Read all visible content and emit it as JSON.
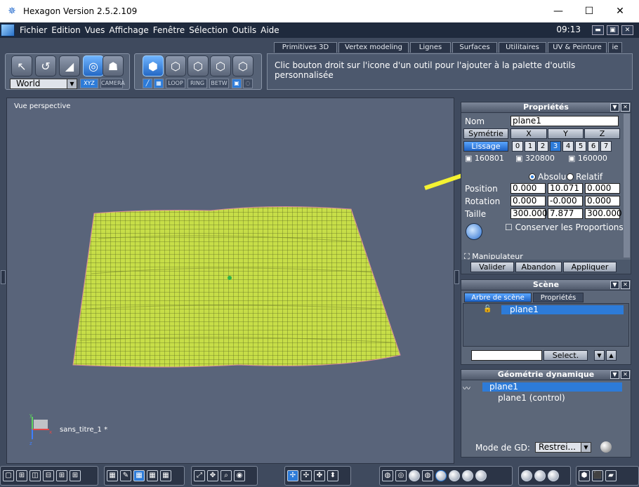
{
  "window": {
    "title": "Hexagon Version 2.5.2.109",
    "minimize": "—",
    "maximize": "☐",
    "close": "✕"
  },
  "menu": {
    "items": [
      "Fichier",
      "Edition",
      "Vues",
      "Affichage",
      "Fenêtre",
      "Sélection",
      "Outils",
      "Aide"
    ],
    "clock": "09:13"
  },
  "tabs": [
    "Primitives 3D",
    "Vertex modeling",
    "Lignes",
    "Surfaces",
    "Utilitaires",
    "UV & Peinture",
    "ie"
  ],
  "hint": "Clic bouton droit sur l'icone d'un outil pour l'ajouter à la palette d'outils personnalisée",
  "toolbar": {
    "coord_select": "World",
    "xyz": "XYZ",
    "camera": "CAMERA",
    "modes": [
      "LOOP",
      "RING",
      "BETW"
    ]
  },
  "viewport": {
    "label": "Vue perspective",
    "doc": "sans_titre_1 *",
    "axes": {
      "x": "x",
      "y": "y",
      "z": "z"
    }
  },
  "props": {
    "title": "Propriétés",
    "name_label": "Nom",
    "name_value": "plane1",
    "symmetry": "Symétrie",
    "axes": [
      "X",
      "Y",
      "Z"
    ],
    "smoothing": "Lissage",
    "levels": [
      "0",
      "1",
      "2",
      "3",
      "4",
      "5",
      "6",
      "7"
    ],
    "selected_level": "3",
    "counts": [
      "160801",
      "320800",
      "160000"
    ],
    "absolute": "Absolu",
    "relative": "Relatif",
    "rows": [
      {
        "label": "Position",
        "v": [
          "0.000",
          "10.071",
          "0.000"
        ]
      },
      {
        "label": "Rotation",
        "v": [
          "0.000",
          "-0.000",
          "0.000"
        ]
      },
      {
        "label": "Taille",
        "v": [
          "300.000",
          "7.877",
          "300.000"
        ]
      }
    ],
    "keep_ratio": "Conserver les Proportions",
    "manipulator": "Manipulateur",
    "validate": "Valider",
    "cancel": "Abandon",
    "apply": "Appliquer"
  },
  "scene": {
    "title": "Scène",
    "tab_tree": "Arbre de scène",
    "tab_props": "Propriétés",
    "item": "plane1",
    "select_btn": "Select."
  },
  "geo": {
    "title": "Géométrie dynamique",
    "item": "plane1",
    "child": "plane1 (control)",
    "mode_label": "Mode de GD:",
    "mode_value": "Restrei..."
  },
  "colors": {
    "accent": "#2d7bd8",
    "mesh": "#c8e04a",
    "arrow": "#f4f232"
  }
}
